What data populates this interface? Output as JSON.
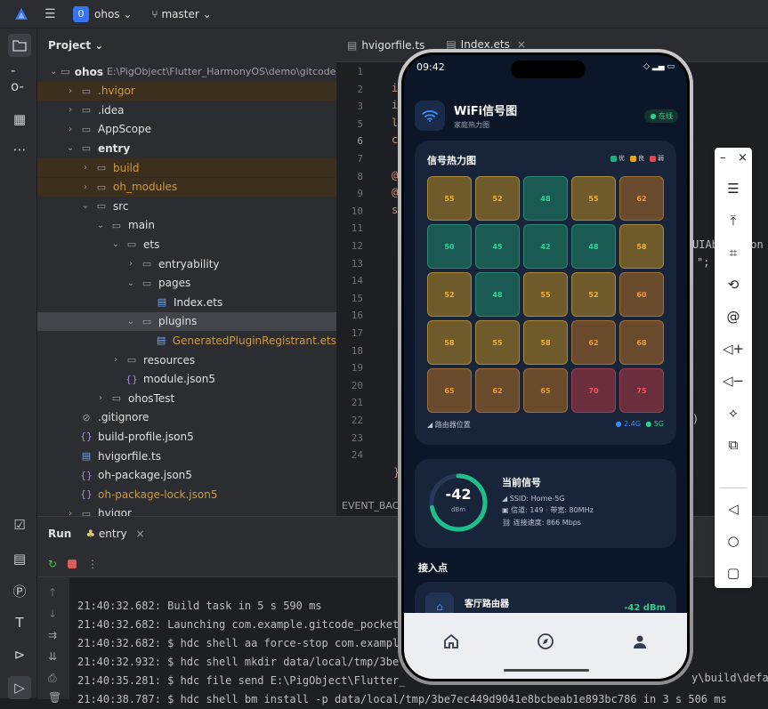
{
  "titlebar": {
    "project_badge": "0",
    "project": "ohos",
    "branch": "master"
  },
  "project_panel": {
    "title": "Project",
    "tree": [
      {
        "label": "ohos",
        "suffix": "E:\\PigObject\\Flutter_HarmonyOS\\demo\\gitcode_p",
        "icon": "folder-icon",
        "level": 0,
        "expanded": true,
        "bold": true
      },
      {
        "label": ".hvigor",
        "icon": "folder-icon",
        "level": 1,
        "orange": true,
        "hl": true
      },
      {
        "label": ".idea",
        "icon": "folder-icon",
        "level": 1
      },
      {
        "label": "AppScope",
        "icon": "folder-icon",
        "level": 1
      },
      {
        "label": "entry",
        "icon": "folder-icon",
        "level": 1,
        "expanded": true,
        "bold": true
      },
      {
        "label": "build",
        "icon": "folder-icon",
        "level": 2,
        "orange": true,
        "hl": true
      },
      {
        "label": "oh_modules",
        "icon": "folder-icon",
        "level": 2,
        "orange": true,
        "hl": true
      },
      {
        "label": "src",
        "icon": "folder-icon",
        "level": 2,
        "expanded": true
      },
      {
        "label": "main",
        "icon": "folder-icon",
        "level": 3,
        "expanded": true
      },
      {
        "label": "ets",
        "icon": "folder-icon",
        "level": 4,
        "expanded": true
      },
      {
        "label": "entryability",
        "icon": "folder-icon",
        "level": 5
      },
      {
        "label": "pages",
        "icon": "folder-icon",
        "level": 5,
        "expanded": true
      },
      {
        "label": "Index.ets",
        "icon": "ets-file-icon",
        "level": 6,
        "leaf": true
      },
      {
        "label": "plugins",
        "icon": "folder-icon",
        "level": 5,
        "expanded": true,
        "sel": true
      },
      {
        "label": "GeneratedPluginRegistrant.ets",
        "icon": "ets-file-icon",
        "level": 6,
        "leaf": true,
        "orange": true
      },
      {
        "label": "resources",
        "icon": "folder-icon",
        "level": 4
      },
      {
        "label": "module.json5",
        "icon": "json-file-icon",
        "level": 4,
        "leaf": true
      },
      {
        "label": "ohosTest",
        "icon": "folder-icon",
        "level": 3
      },
      {
        "label": ".gitignore",
        "icon": "ignore-file-icon",
        "level": 1,
        "leaf": true
      },
      {
        "label": "build-profile.json5",
        "icon": "json-file-icon",
        "level": 1,
        "leaf": true
      },
      {
        "label": "hvigorfile.ts",
        "icon": "ts-file-icon",
        "level": 1,
        "leaf": true
      },
      {
        "label": "oh-package.json5",
        "icon": "json-file-icon",
        "level": 1,
        "leaf": true
      },
      {
        "label": "oh-package-lock.json5",
        "icon": "json-file-icon",
        "level": 1,
        "leaf": true,
        "orange": true
      },
      {
        "label": "hvigor",
        "icon": "folder-icon",
        "level": 1
      }
    ]
  },
  "editor": {
    "tabs": [
      {
        "label": "hvigorfile.ts"
      },
      {
        "label": "Index.ets",
        "close": "×"
      }
    ],
    "line_numbers": [
      "1",
      "2",
      "3",
      "5",
      "6",
      "7",
      "8",
      "9",
      "10",
      "11",
      "12",
      "13",
      "14",
      "15",
      "16",
      "17",
      "18",
      "19",
      "20",
      "21",
      "22",
      "23",
      "24"
    ],
    "current_line": "6",
    "code_fragments": [
      {
        "text": "i",
        "line": 1
      },
      {
        "text": "i",
        "line": 2
      },
      {
        "text": "l",
        "line": 3
      },
      {
        "text": "c",
        "line": 4
      },
      {
        "text": "@",
        "line": 6
      },
      {
        "text": "@",
        "line": 7
      },
      {
        "text": "s",
        "line": 8
      }
    ],
    "right_fragments": [
      {
        "text": "UIAb",
        "line": 10
      },
      {
        "text": "\";",
        "line": 11
      },
      {
        "text": "Con",
        "line": 10
      },
      {
        "text": ")",
        "line": 20
      }
    ],
    "bottom_tab": "EVENT_BAC",
    "closing_brace": "}"
  },
  "run_panel": {
    "title": "Run",
    "config": "entry",
    "close": "×",
    "console": [
      "21:40:32.682: Build task in 5 s 590 ms",
      "21:40:32.682: Launching com.example.gitcode_pocket",
      "21:40:32.682: $ hdc shell aa force-stop com.exampl",
      "21:40:32.932: $ hdc shell mkdir data/local/tmp/3be",
      "21:40:35.281: $ hdc file send E:\\PigObject\\Flutter_",
      "21:40:38.787: $ hdc shell bm install -p data/local/tmp/3be7ec449d9041e8bcbeab1e893bc786 in 3 s 506 ms"
    ],
    "console_tail": "y\\build\\defau"
  },
  "phone": {
    "time": "09:42",
    "app_title": "WiFi信号图",
    "app_subtitle": "家庭热力图",
    "status": "● 在线",
    "heatmap": {
      "title": "信号热力图",
      "legend": [
        {
          "label": "优",
          "color": "#1db07a"
        },
        {
          "label": "良",
          "color": "#e9a21a"
        },
        {
          "label": "弱",
          "color": "#e5484d"
        }
      ],
      "rows": [
        [
          "55",
          "52",
          "48",
          "55",
          "62"
        ],
        [
          "50",
          "45",
          "42",
          "48",
          "58"
        ],
        [
          "52",
          "48",
          "55",
          "52",
          "60"
        ],
        [
          "58",
          "55",
          "58",
          "62",
          "68"
        ],
        [
          "65",
          "62",
          "65",
          "70",
          "75"
        ]
      ],
      "footer_left": "路由器位置",
      "footer_24": "● 2.4G",
      "footer_5": "● 5G"
    },
    "signal": {
      "value": "-42",
      "unit": "dBm",
      "title": "当前信号",
      "ssid": "SSID: Home-5G",
      "channel": "信道: 149 · 带宽: 80MHz",
      "speed": "连接速度: 866 Mbps",
      "strength_fraction": 0.72
    },
    "section_title": "接入点",
    "access_point": {
      "name": "客厅路由器",
      "dbm": "-42 dBm"
    },
    "nav": [
      {
        "icon": "home-icon"
      },
      {
        "icon": "compass-icon"
      },
      {
        "icon": "person-icon"
      }
    ]
  },
  "emulator_toolbar": {
    "minimize": "–",
    "close": "×",
    "tools": [
      "menu-icon",
      "pin-top-icon",
      "crop-icon",
      "rotate-icon",
      "at-icon",
      "volume-up-icon",
      "volume-down-icon",
      "shake-icon",
      "multi-screen-icon",
      "back-icon",
      "home-icon",
      "recents-icon"
    ]
  },
  "colors": {
    "good": "#1e7a61",
    "mid": "#8a6a2c",
    "weak": "#8a3a45",
    "accent": "#3574f0"
  }
}
